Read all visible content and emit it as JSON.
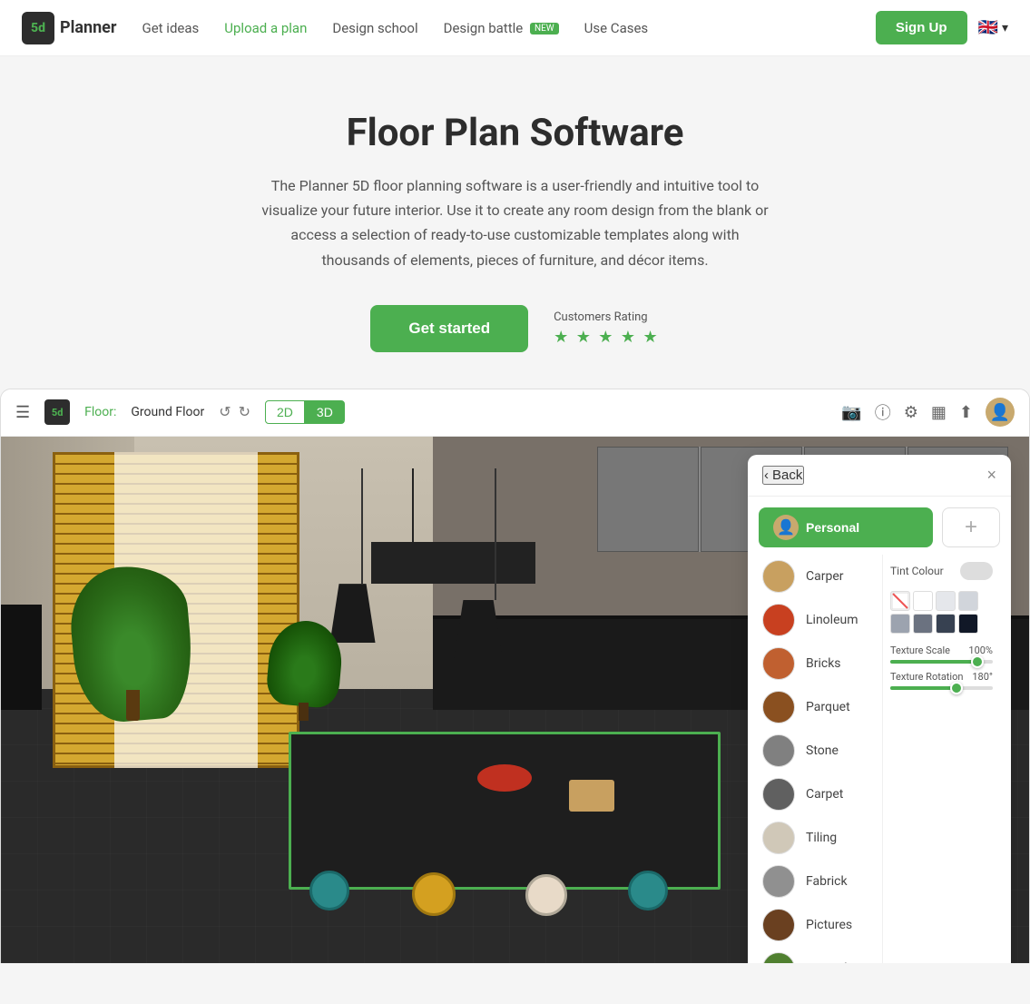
{
  "nav": {
    "logo_text": "Planner",
    "logo_suffix": "5d",
    "links": [
      {
        "id": "get-ideas",
        "label": "Get ideas",
        "active": false
      },
      {
        "id": "upload-plan",
        "label": "Upload a plan",
        "active": true
      },
      {
        "id": "design-school",
        "label": "Design school",
        "active": false
      },
      {
        "id": "design-battle",
        "label": "Design battle",
        "active": false,
        "badge": "NEW"
      },
      {
        "id": "use-cases",
        "label": "Use Cases",
        "active": false
      }
    ],
    "signup_label": "Sign Up",
    "lang": "EN"
  },
  "hero": {
    "title": "Floor Plan Software",
    "description": "The Planner 5D floor planning software is a user-friendly and intuitive tool to visualize your future interior. Use it to create any room design from the blank or access a selection of ready-to-use customizable templates along with thousands of elements, pieces of furniture, and décor items.",
    "cta_label": "Get started",
    "rating_label": "Customers Rating",
    "stars": "★ ★ ★ ★ ★"
  },
  "app": {
    "floor_label": "Floor:",
    "floor_name": "Ground Floor",
    "view_2d": "2D",
    "view_3d": "3D",
    "active_view": "3D"
  },
  "panel": {
    "back_label": "Back",
    "close_label": "×",
    "personal_label": "Personal",
    "add_label": "+",
    "materials": [
      {
        "id": "carper",
        "name": "Carper",
        "color": "#c8a060"
      },
      {
        "id": "linoleum",
        "name": "Linoleum",
        "color": "#c84020"
      },
      {
        "id": "bricks",
        "name": "Bricks",
        "color": "#c06030"
      },
      {
        "id": "parquet",
        "name": "Parquet",
        "color": "#8a5020"
      },
      {
        "id": "stone",
        "name": "Stone",
        "color": "#808080"
      },
      {
        "id": "carpet",
        "name": "Carpet",
        "color": "#606060"
      },
      {
        "id": "tiling",
        "name": "Tiling",
        "color": "#d0c8b8"
      },
      {
        "id": "fabrick",
        "name": "Fabrick",
        "color": "#909090"
      },
      {
        "id": "pictures",
        "name": "Pictures",
        "color": "#6a4020"
      },
      {
        "id": "ground",
        "name": "Ground",
        "color": "#508030"
      }
    ],
    "tint_label": "Tint Colour",
    "tint_enabled": false,
    "swatches": [
      "#f87171",
      "#fff",
      "#e5e7eb",
      "#d1d5db",
      "#9ca3af",
      "#6b7280",
      "#374151",
      "#111827"
    ],
    "texture_scale_label": "Texture Scale",
    "texture_scale_value": "100%",
    "texture_scale_pct": 85,
    "texture_rotation_label": "Texture Rotation",
    "texture_rotation_value": "180°",
    "texture_rotation_pct": 65
  }
}
